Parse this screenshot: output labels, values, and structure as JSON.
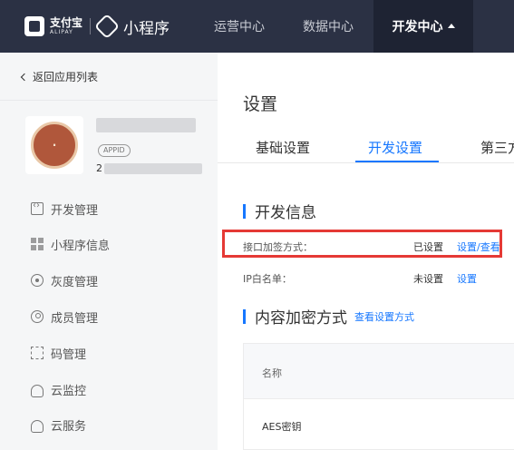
{
  "topbar": {
    "alipay_cn": "支付宝",
    "alipay_en": "ALIPAY",
    "product_name": "小程序",
    "nav": [
      {
        "label": "运营中心"
      },
      {
        "label": "数据中心"
      },
      {
        "label": "开发中心"
      }
    ],
    "active_index": 2
  },
  "sidebar": {
    "back_label": "返回应用列表",
    "app_badge": "APPID",
    "appid_prefix": "2",
    "items": [
      {
        "label": "开发管理",
        "icon": "code-icon"
      },
      {
        "label": "小程序信息",
        "icon": "grid-icon"
      },
      {
        "label": "灰度管理",
        "icon": "radar-icon"
      },
      {
        "label": "成员管理",
        "icon": "user-icon"
      },
      {
        "label": "码管理",
        "icon": "qrcode-icon"
      },
      {
        "label": "云监控",
        "icon": "cloud-icon"
      },
      {
        "label": "云服务",
        "icon": "cloud-icon"
      }
    ]
  },
  "main": {
    "title": "设置",
    "tabs": [
      {
        "label": "基础设置"
      },
      {
        "label": "开发设置"
      },
      {
        "label": "第三方"
      }
    ],
    "active_tab": 1,
    "dev_info": {
      "title": "开发信息",
      "rows": [
        {
          "label": "接口加签方式：",
          "status": "已设置",
          "action": "设置/查看"
        },
        {
          "label": "IP白名单：",
          "status": "未设置",
          "action": "设置"
        }
      ]
    },
    "encryption": {
      "title": "内容加密方式",
      "link": "查看设置方式",
      "table_header": "名称",
      "rows": [
        {
          "name": "AES密钥"
        }
      ]
    }
  },
  "colors": {
    "topbar_bg": "#2b3144",
    "accent": "#1677ff",
    "highlight": "#e53935"
  }
}
